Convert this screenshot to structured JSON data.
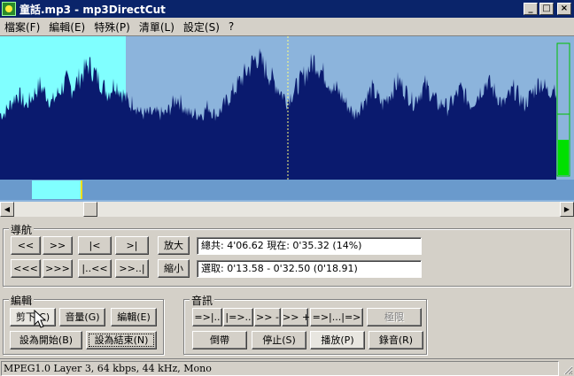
{
  "window": {
    "title": "童話.mp3 - mp3DirectCut",
    "controls": {
      "minimize": "_",
      "maximize": "□",
      "close": "×"
    }
  },
  "menu": [
    "檔案(F)",
    "編輯(E)",
    "特殊(P)",
    "清單(L)",
    "設定(S)",
    "?"
  ],
  "colors": {
    "waveform": "#0a1a6e",
    "background": "#8cb4dc",
    "selection": "#80ffff",
    "meter": "#00e000"
  },
  "navigation": {
    "label": "導航",
    "buttons": [
      "<<",
      ">>",
      "|<",
      ">|",
      "<<<",
      ">>>",
      "|..<<",
      ">>..|"
    ],
    "zoom_in": "放大",
    "zoom_out": "縮小",
    "position_text": "總共: 4'06.62  現在: 0'35.32  (14%)",
    "selection_text": "選取: 0'13.58 - 0'32.50 (0'18.91)"
  },
  "edit": {
    "label": "編輯",
    "cut": "剪下(C)",
    "volume": "音量(G)",
    "edit": "編輯(E)",
    "set_start": "設為開始(B)",
    "set_end": "設為結束(N)"
  },
  "audio": {
    "label": "音訊",
    "play_prev": "=>|..",
    "play_start": "|=>..",
    "back": ">> -",
    "fwd": ">> +",
    "play_sel": "=>|...|=>",
    "limit": "極限",
    "reverse": "倒帶",
    "stop": "停止(S)",
    "play": "播放(P)",
    "record": "錄音(R)"
  },
  "status": "MPEG1.0 Layer 3, 64 kbps, 44 kHz, Mono",
  "waveform": {
    "selection_start_sec": 13.58,
    "selection_end_sec": 32.5,
    "cursor_sec": 35.32,
    "total_sec": 246.62,
    "scroll_position": 0.14
  }
}
